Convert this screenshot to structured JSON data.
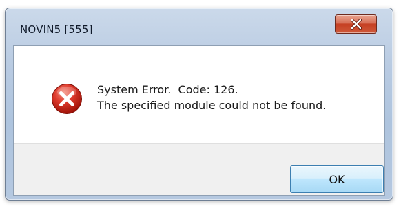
{
  "window": {
    "title": "NOVIN5 [555]",
    "close_icon": "close-icon"
  },
  "message": {
    "icon": "error-icon",
    "line1": "System Error.  Code: 126.",
    "line2": "The specified module could not be found."
  },
  "buttons": {
    "ok_label": "OK"
  },
  "colors": {
    "frame": "#b9cbe2",
    "close_button": "#c53f22",
    "error_icon": "#d32f2f",
    "ok_button_border": "#3c7fb1"
  }
}
